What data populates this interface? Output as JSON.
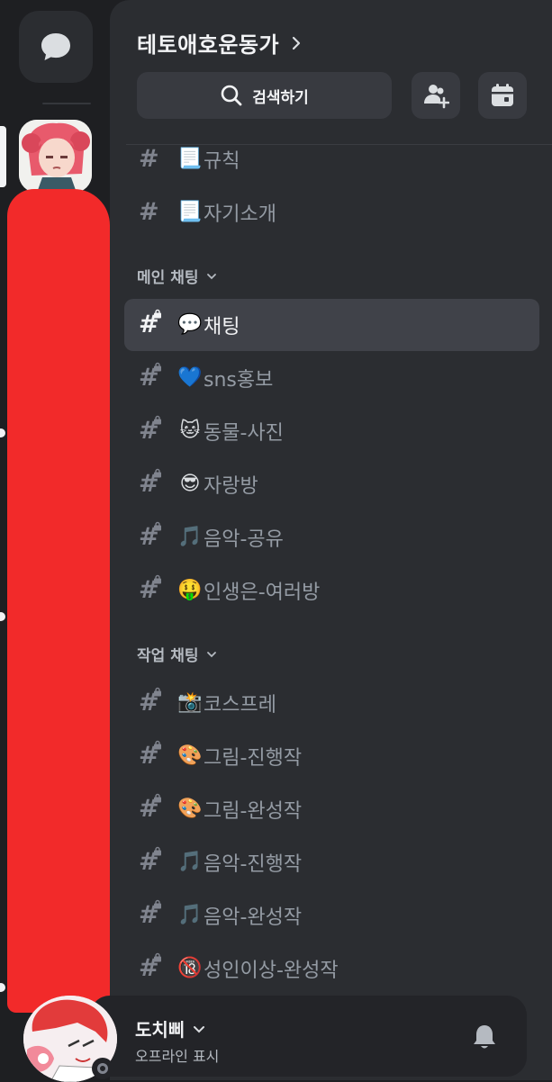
{
  "guild": {
    "name": "테토애호운동가"
  },
  "search": {
    "label": "검색하기"
  },
  "channels_top": [
    {
      "emoji": "📃",
      "name": "규칙"
    },
    {
      "emoji": "📃",
      "name": "자기소개"
    }
  ],
  "categories": [
    {
      "label": "메인 채팅",
      "channels": [
        {
          "emoji": "💬",
          "name": "채팅"
        },
        {
          "emoji": "💙",
          "name": "sns홍보"
        },
        {
          "emoji": "🐱",
          "name": "동물-사진"
        },
        {
          "emoji": "😎",
          "name": "자랑방"
        },
        {
          "emoji": "🎵",
          "name": "음악-공유"
        },
        {
          "emoji": "🤑",
          "name": "인생은-여러방"
        }
      ]
    },
    {
      "label": "작업 채팅",
      "channels": [
        {
          "emoji": "📸",
          "name": "코스프레"
        },
        {
          "emoji": "🎨",
          "name": "그림-진행작"
        },
        {
          "emoji": "🎨",
          "name": "그림-완성작"
        },
        {
          "emoji": "🎵",
          "name": "음악-진행작"
        },
        {
          "emoji": "🎵",
          "name": "음악-완성작"
        },
        {
          "emoji": "🔞",
          "name": "성인이상-완성작"
        }
      ]
    }
  ],
  "user": {
    "name": "도치삐",
    "status": "오프라인 표시"
  },
  "colors": {
    "selected_bg": "#404249",
    "redaction": "#f22a2a",
    "panel_bg": "#2b2d31",
    "rail_bg": "#1e1f22"
  },
  "icons": [
    "chat-bubble-icon",
    "chevron-right-icon",
    "search-icon",
    "add-member-icon",
    "calendar-icon",
    "hash-icon",
    "lock-icon",
    "chevron-down-icon",
    "bell-icon"
  ]
}
